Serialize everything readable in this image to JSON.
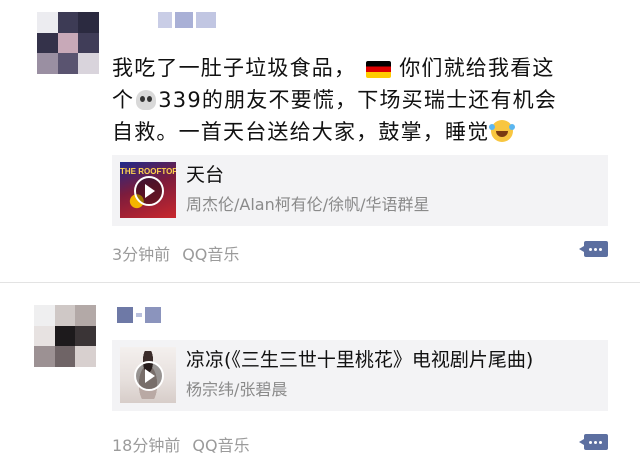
{
  "posts": [
    {
      "text_line1": "我吃了一肚子垃圾食品，",
      "text_line1_tail": "你们就给我看这",
      "text_line2_head": "个",
      "text_line2_tail": "339的朋友不要慌，下场买瑞士还有机会",
      "text_line3": "自救。一首天台送给大家，鼓掌，睡觉",
      "emoji_flag": "flag-germany",
      "emoji_skull": "skull",
      "emoji_end": "laughing-crying-face",
      "music": {
        "cover_text": "THE ROOFTOP",
        "title": "天台",
        "artist": "周杰伦/Alan柯有伦/徐帆/华语群星"
      },
      "time": "3分钟前",
      "source": "QQ音乐"
    },
    {
      "music": {
        "title": "凉凉(《三生三世十里桃花》电视剧片尾曲)",
        "artist": "杨宗纬/张碧晨"
      },
      "time": "18分钟前",
      "source": "QQ音乐"
    }
  ],
  "colors": {
    "link_blue": "#5c6fa0",
    "meta_gray": "#9b9b9b",
    "card_bg": "#f3f3f5"
  }
}
